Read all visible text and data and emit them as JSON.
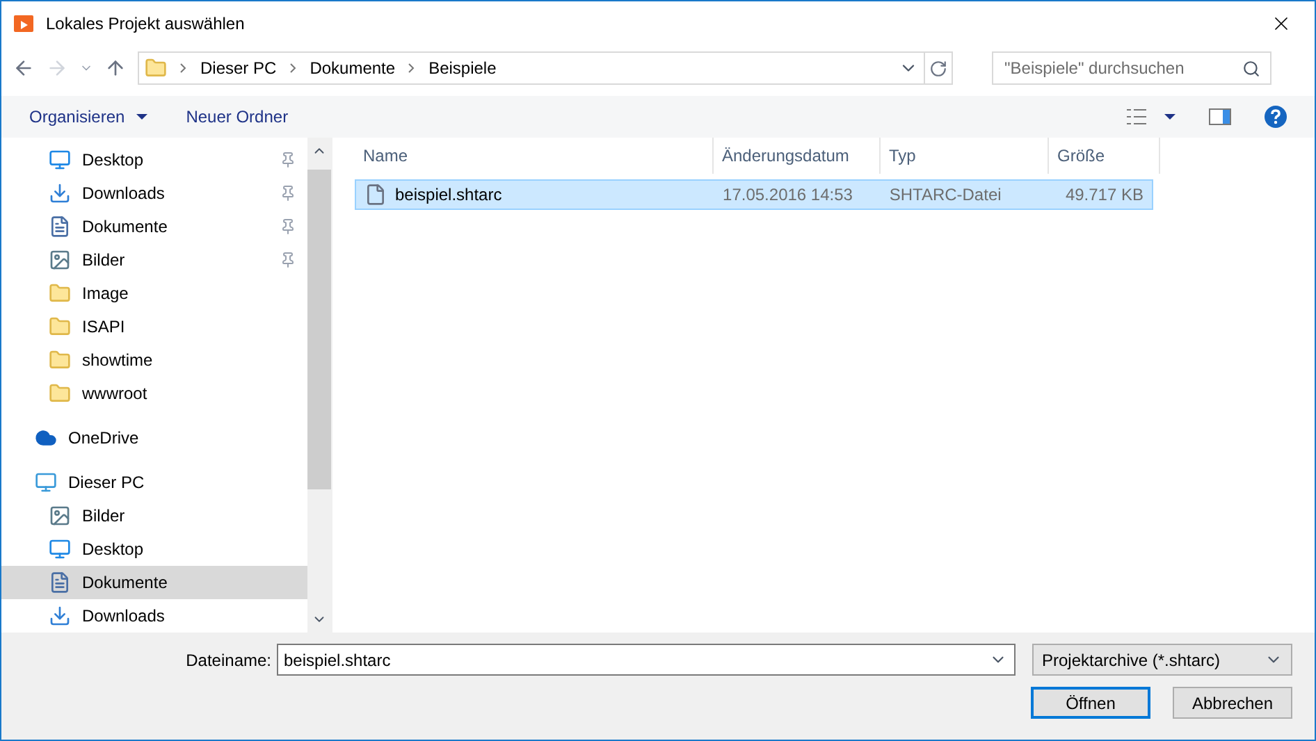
{
  "window": {
    "title": "Lokales Projekt auswählen"
  },
  "address": {
    "path": [
      "Dieser PC",
      "Dokumente",
      "Beispiele"
    ]
  },
  "search": {
    "placeholder": "\"Beispiele\" durchsuchen"
  },
  "toolbar": {
    "organize": "Organisieren",
    "new_folder": "Neuer Ordner"
  },
  "sidebar": {
    "items": [
      {
        "children": [
          {
            "label": "Desktop",
            "kind": "desktop",
            "pinned": true,
            "selected": false
          },
          {
            "label": "Downloads",
            "kind": "download",
            "pinned": true,
            "selected": false
          },
          {
            "label": "Dokumente",
            "kind": "document",
            "pinned": true,
            "selected": false
          },
          {
            "label": "Bilder",
            "kind": "pictures",
            "pinned": true,
            "selected": false
          },
          {
            "label": "Image",
            "kind": "folder",
            "pinned": false,
            "selected": false
          },
          {
            "label": "ISAPI",
            "kind": "folder",
            "pinned": false,
            "selected": false
          },
          {
            "label": "showtime",
            "kind": "folder",
            "pinned": false,
            "selected": false
          },
          {
            "label": "wwwroot",
            "kind": "folder",
            "pinned": false,
            "selected": false
          }
        ]
      },
      {
        "label": "OneDrive",
        "kind": "cloud",
        "selected": false
      },
      {
        "label": "Dieser PC",
        "kind": "pc",
        "selected": false,
        "children": [
          {
            "label": "Bilder",
            "kind": "pictures",
            "pinned": false,
            "selected": false
          },
          {
            "label": "Desktop",
            "kind": "desktop",
            "pinned": false,
            "selected": false
          },
          {
            "label": "Dokumente",
            "kind": "document",
            "pinned": false,
            "selected": true
          },
          {
            "label": "Downloads",
            "kind": "download",
            "pinned": false,
            "selected": false
          }
        ]
      }
    ]
  },
  "table": {
    "columns": [
      "Name",
      "Änderungsdatum",
      "Typ",
      "Größe"
    ],
    "rows": [
      {
        "cells": [
          "beispiel.shtarc",
          "17.05.2016 14:53",
          "SHTARC-Datei",
          "49.717 KB"
        ],
        "selected": true
      }
    ]
  },
  "footer": {
    "filename_label": "Dateiname:",
    "filename": "beispiel.shtarc",
    "filter": "Projektarchive (*.shtarc)",
    "buttons": [
      "Öffnen",
      "Abbrechen"
    ]
  }
}
